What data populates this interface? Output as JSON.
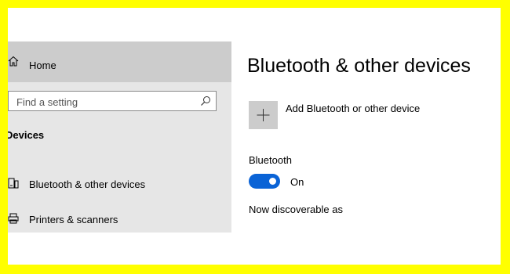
{
  "sidebar": {
    "home_label": "Home",
    "search": {
      "placeholder": "Find a setting"
    },
    "section_title": "Devices",
    "items": [
      {
        "label": "Bluetooth & other devices",
        "icon": "bluetooth-devices-icon"
      },
      {
        "label": "Printers & scanners",
        "icon": "printer-icon"
      }
    ]
  },
  "main": {
    "title": "Bluetooth & other devices",
    "add_device_label": "Add Bluetooth or other device",
    "bluetooth_heading": "Bluetooth",
    "toggle": {
      "state_label": "On",
      "on": true
    },
    "status_text": "Now discoverable as"
  },
  "colors": {
    "border": "#ffff00",
    "sidebar_bg": "#e6e6e6",
    "selected_bg": "#cccccc",
    "accent": "#0a63d6"
  }
}
